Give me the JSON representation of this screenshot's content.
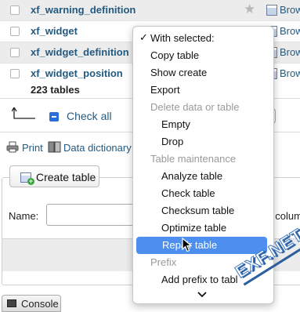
{
  "rows": [
    {
      "name": "xf_warning_definition",
      "browse": "Brow"
    },
    {
      "name": "xf_widget",
      "browse": "Brow"
    },
    {
      "name": "xf_widget_definition",
      "browse": "Brow"
    },
    {
      "name": "xf_widget_position",
      "browse": "Brow"
    }
  ],
  "summary": {
    "count": "223 tables"
  },
  "bulk": {
    "check_all": "Check all"
  },
  "links": {
    "print": "Print",
    "data_dictionary": "Data dictionary"
  },
  "create": {
    "button": "Create table",
    "name_label": "Name:",
    "columns_partial": "f colum"
  },
  "console": {
    "label": "Console"
  },
  "menu": {
    "header": "With selected:",
    "items": [
      {
        "label": "Copy table",
        "disabled": false
      },
      {
        "label": "Show create",
        "disabled": false
      },
      {
        "label": "Export",
        "disabled": false
      },
      {
        "label": "Delete data or table",
        "disabled": true
      },
      {
        "label": "Empty",
        "disabled": false
      },
      {
        "label": "Drop",
        "disabled": false
      },
      {
        "label": "Table maintenance",
        "disabled": true
      },
      {
        "label": "Analyze table",
        "disabled": false
      },
      {
        "label": "Check table",
        "disabled": false
      },
      {
        "label": "Checksum table",
        "disabled": false
      },
      {
        "label": "Optimize table",
        "disabled": false
      },
      {
        "label": "Repair table",
        "disabled": false
      },
      {
        "label": "Prefix",
        "disabled": true
      },
      {
        "label": "Add prefix to tabl",
        "disabled": false
      }
    ]
  },
  "watermark": {
    "text": "EXF.NET"
  },
  "colors": {
    "link": "#235a81",
    "highlight": "#4d8fef",
    "row_alt": "#ececec"
  }
}
